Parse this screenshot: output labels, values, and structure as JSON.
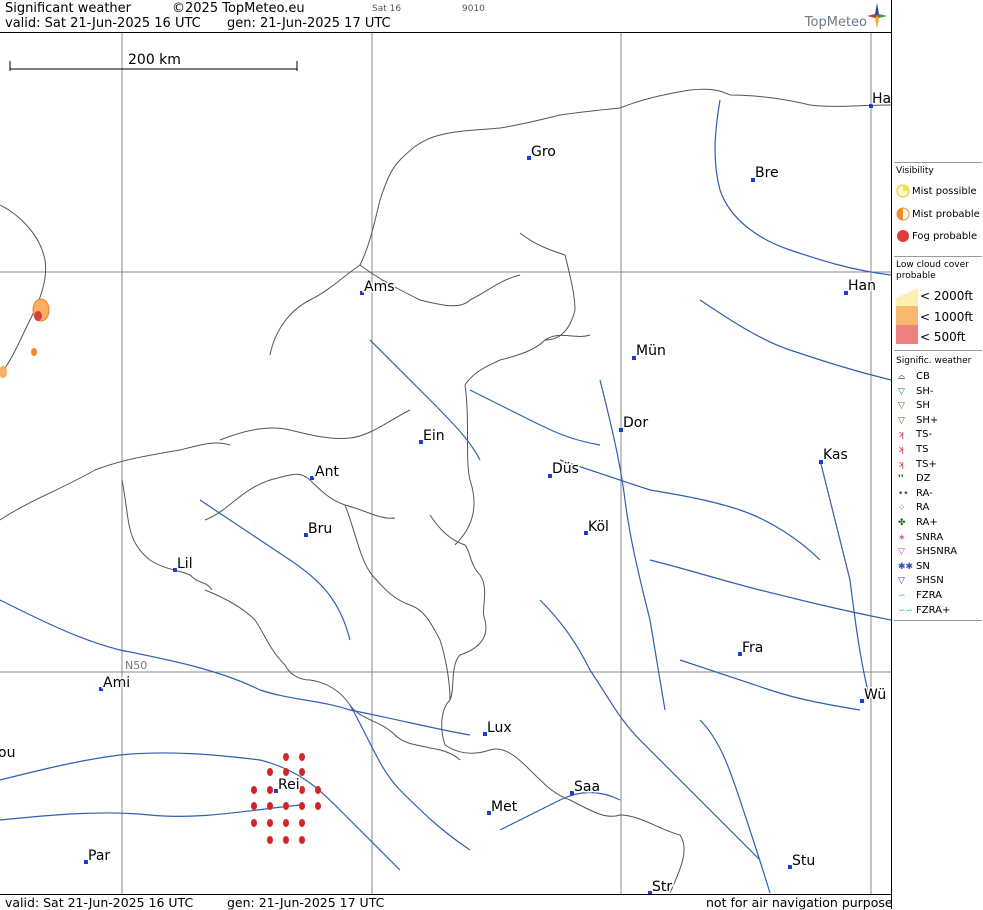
{
  "header": {
    "title": "Significant weather",
    "copyright": "©2025 TopMeteo.eu",
    "day": "Sat 16",
    "code": "9010",
    "valid": "valid:  Sat  21-Jun-2025  16 UTC",
    "gen": "gen: 21-Jun-2025 17 UTC",
    "logo": "TopMeteo"
  },
  "footer": {
    "valid": "valid:  Sat  21-Jun-2025  16 UTC",
    "gen": "gen: 21-Jun-2025 17 UTC",
    "disclaimer": "not for air navigation purposes"
  },
  "map": {
    "scale_label": "200 km",
    "latitude_label": "N50",
    "cities": [
      "Ha",
      "Gro",
      "Bre",
      "Ams",
      "Han",
      "Mün",
      "Dor",
      "Ein",
      "Kas",
      "Ant",
      "Düs",
      "Köl",
      "Bru",
      "Lil",
      "Fra",
      "Ami",
      "Wü",
      "Lux",
      "ou",
      "Rei",
      "Saa",
      "Met",
      "Par",
      "Stu",
      "Str"
    ]
  },
  "legend": {
    "visibility_title": "Visibility",
    "visibility": [
      {
        "label": "Mist possible",
        "color": "#f5e04a"
      },
      {
        "label": "Mist probable",
        "color": "#f28c28"
      },
      {
        "label": "Fog probable",
        "color": "#e03c3c"
      }
    ],
    "cloud_title": "Low cloud cover probable",
    "cloud": [
      {
        "label": "< 2000ft",
        "color": "#fbf0b0"
      },
      {
        "label": "< 1000ft",
        "color": "#f9b870"
      },
      {
        "label": "<   500ft",
        "color": "#f08080"
      }
    ],
    "weather_title": "Signific. weather",
    "weather": [
      {
        "label": "CB",
        "icon": "cb-icon",
        "color": "#000000"
      },
      {
        "label": "SH-",
        "icon": "shower-light-icon",
        "color": "#2a8a2a"
      },
      {
        "label": "SH",
        "icon": "shower-icon",
        "color": "#2a8a2a"
      },
      {
        "label": "SH+",
        "icon": "shower-heavy-icon",
        "color": "#2a8a2a"
      },
      {
        "label": "TS-",
        "icon": "thunderstorm-light-icon",
        "color": "#d03030"
      },
      {
        "label": "TS",
        "icon": "thunderstorm-icon",
        "color": "#d03030"
      },
      {
        "label": "TS+",
        "icon": "thunderstorm-heavy-icon",
        "color": "#d03030"
      },
      {
        "label": "DZ",
        "icon": "drizzle-icon",
        "color": "#1a6a1a"
      },
      {
        "label": "RA-",
        "icon": "rain-light-icon",
        "color": "#1a6a1a"
      },
      {
        "label": "RA",
        "icon": "rain-icon",
        "color": "#1a6a1a"
      },
      {
        "label": "RA+",
        "icon": "rain-heavy-icon",
        "color": "#1a6a1a"
      },
      {
        "label": "SNRA",
        "icon": "snow-rain-icon",
        "color": "#c040c0"
      },
      {
        "label": "SHSNRA",
        "icon": "snow-rain-shower-icon",
        "color": "#c040c0"
      },
      {
        "label": "SN",
        "icon": "snow-icon",
        "color": "#3050c0"
      },
      {
        "label": "SHSN",
        "icon": "snow-shower-icon",
        "color": "#3050c0"
      },
      {
        "label": "FZRA",
        "icon": "freezing-rain-icon",
        "color": "#20b0c0"
      },
      {
        "label": "FZRA+",
        "icon": "freezing-rain-heavy-icon",
        "color": "#20b0c0"
      }
    ]
  },
  "colors": {
    "border": "#555555",
    "river": "#2e5fb5",
    "grid": "#8a8a8a",
    "rain_dot": "#d02828",
    "city_marker": "#1a3ad0"
  }
}
